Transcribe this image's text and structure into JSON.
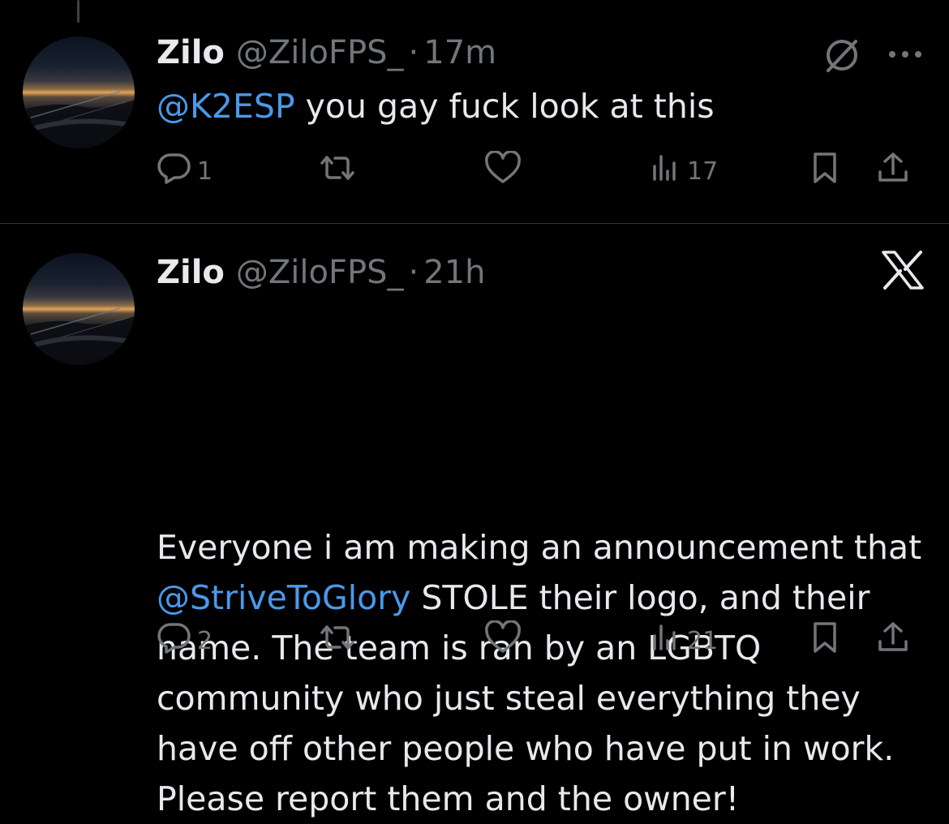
{
  "tweets": [
    {
      "author_name": "Zilo",
      "handle": "@ZiloFPS_",
      "separator": "·",
      "time": "17m",
      "mention": "@K2ESP",
      "text_after": " you gay fuck look at this",
      "top_icons": [
        "grok-icon",
        "more-icon"
      ],
      "replies": "1",
      "views": "17"
    },
    {
      "author_name": "Zilo",
      "handle": "@ZiloFPS_",
      "separator": "·",
      "time": "21h",
      "text_before": "Everyone i am making an announcement that ",
      "mention": "@StriveToGlory",
      "text_after": " STOLE their logo, and their name. The team is ran by an LGBTQ community who just steal everything they have off other people who have put in work. Please report them and the owner!",
      "top_icons": [
        "x-logo-icon"
      ],
      "replies": "2",
      "views": "21"
    }
  ],
  "colors": {
    "background": "#000000",
    "text": "#e7e9ea",
    "secondary": "#71767b",
    "mention": "#4a99e9",
    "divider": "#2f3336"
  }
}
